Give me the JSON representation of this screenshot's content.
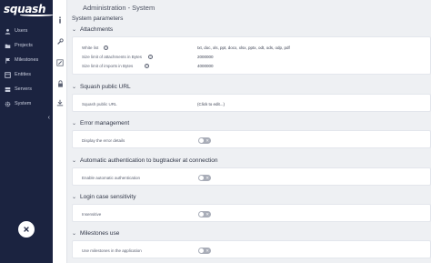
{
  "brand": {
    "logo_text": "squash"
  },
  "sidebar": {
    "items": [
      {
        "label": "Users",
        "icon": "users-icon"
      },
      {
        "label": "Projects",
        "icon": "folder-icon"
      },
      {
        "label": "Milestones",
        "icon": "flag-icon"
      },
      {
        "label": "Entities",
        "icon": "entities-icon"
      },
      {
        "label": "Servers",
        "icon": "servers-icon"
      },
      {
        "label": "System",
        "icon": "gear-icon"
      }
    ],
    "collapse_glyph": "‹",
    "close_glyph": "✕"
  },
  "icon_strip": {
    "items": [
      {
        "name": "info-icon",
        "glyph": "ℹ"
      },
      {
        "name": "wrench-icon",
        "glyph": ""
      },
      {
        "name": "edit-icon",
        "glyph": ""
      },
      {
        "name": "lock-icon",
        "glyph": ""
      },
      {
        "name": "download-icon",
        "glyph": ""
      }
    ]
  },
  "header": {
    "title": "Administration - System",
    "subtitle": "System parameters"
  },
  "sections": {
    "attachments": {
      "title": "Attachments",
      "white_list_label": "White list",
      "white_list_value": "txt, doc, xls, ppt, docx, xlsx, pptx, odt, ods, odp, pdf",
      "size_limit_attachments_label": "Size limit of attachments in Bytes",
      "size_limit_attachments_value": "2000000",
      "size_limit_imports_label": "Size limit of imports in Bytes",
      "size_limit_imports_value": "4000000"
    },
    "squash_url": {
      "title": "Squash public URL",
      "url_label": "Squash public URL",
      "url_placeholder": "(Click to edit...)"
    },
    "error_management": {
      "title": "Error management",
      "display_label": "Display the error details",
      "enabled": false
    },
    "auto_auth": {
      "title": "Automatic authentication to bugtracker at connection",
      "enable_label": "Enable automatic authentication",
      "enabled": false
    },
    "login_case": {
      "title": "Login case sensitivity",
      "insensitive_label": "Insensitive",
      "enabled": false
    },
    "milestones": {
      "title": "Milestones use",
      "use_label": "Use milestones in the application",
      "enabled": false
    }
  },
  "glyphs": {
    "section_chevron": "⌄",
    "help": "?",
    "toggle_off": "✕"
  }
}
